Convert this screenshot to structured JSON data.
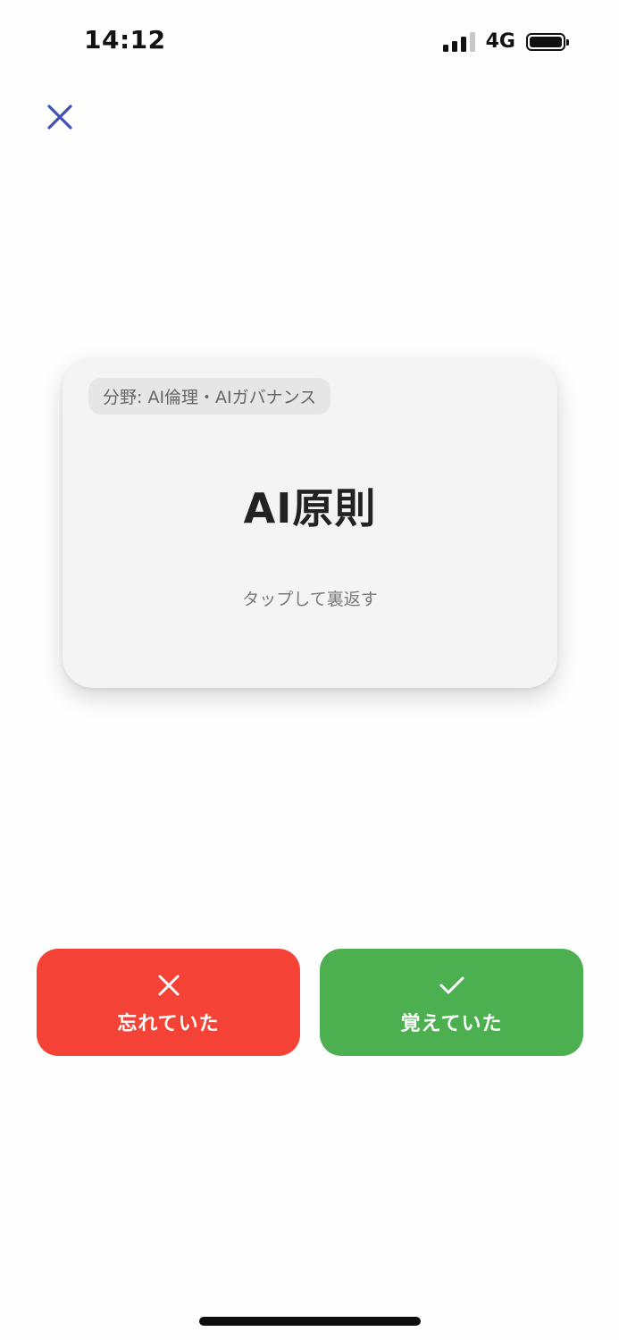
{
  "status_bar": {
    "time": "14:12",
    "network": "4G",
    "signal_bars_active": 3,
    "signal_bars_total": 4,
    "battery_level": 1.0
  },
  "header": {
    "close_icon": "close-icon",
    "close_color": "#3f51b5"
  },
  "card": {
    "category_label": "分野: AI倫理・AIガバナンス",
    "term": "AI原則",
    "hint": "タップして裏返す"
  },
  "actions": {
    "forgot": {
      "label": "忘れていた",
      "icon": "x-icon",
      "color": "#f44336"
    },
    "remembered": {
      "label": "覚えていた",
      "icon": "check-icon",
      "color": "#4caf50"
    }
  }
}
